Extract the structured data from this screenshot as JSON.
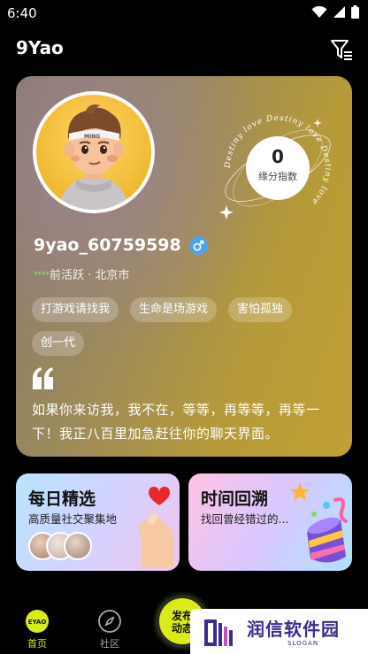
{
  "status_bar": {
    "time": "6:40",
    "icons": [
      "wifi-icon",
      "signal-icon",
      "battery-icon"
    ]
  },
  "header": {
    "title": "9Yao",
    "filter_icon": "filter-icon"
  },
  "profile": {
    "avatar_caption": "MING",
    "destiny": {
      "value": "0",
      "label": "缘分指数",
      "ring_text": "Destiny love Destiny love Destiny love"
    },
    "username": "9yao_60759598",
    "gender_icon": "male-icon",
    "activity_stars": "****",
    "activity_status": "前活跃 · 北京市",
    "tags": [
      "打游戏请找我",
      "生命是场游戏",
      "害怕孤独",
      "创一代"
    ],
    "quote": "如果你来访我，我不在，等等，再等等，再等一下！我正八百里加急赶往你的聊天界面。"
  },
  "features": {
    "daily": {
      "title": "每日精选",
      "subtitle": "高质量社交聚集地"
    },
    "time": {
      "title": "时间回溯",
      "subtitle": "找回曾经错过的..."
    }
  },
  "bottom_nav": {
    "home": {
      "label": "首页",
      "icon_text": "EYAO"
    },
    "community": {
      "label": "社区"
    },
    "publish": {
      "line1": "发布",
      "line2": "动态"
    }
  },
  "watermark": {
    "title": "润信软件园",
    "slogan": "SLOGAN"
  },
  "colors": {
    "accent_green": "#d9ec17",
    "gender_blue": "#4aa3f0",
    "star_green": "#7cf05a",
    "watermark_purple": "#3b2d8f"
  }
}
